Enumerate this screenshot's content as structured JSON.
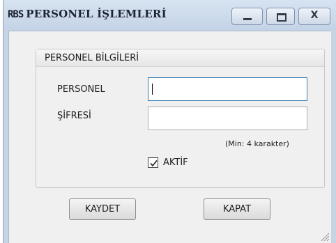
{
  "window": {
    "app_tag": "RBS",
    "title": "PERSONEL İŞLEMLERİ",
    "controls": {
      "minimize_icon": "minimize-icon",
      "maximize_icon": "maximize-icon",
      "close_icon": "close-icon",
      "close_glyph": "X"
    }
  },
  "group": {
    "title": "PERSONEL BİLGİLERİ"
  },
  "form": {
    "personel_label": "PERSONEL",
    "personel_value": "",
    "sifre_label": "ŞİFRESİ",
    "sifre_value": "",
    "sifre_hint": "(Min: 4 karakter)",
    "aktif_label": "AKTİF",
    "aktif_checked": true
  },
  "buttons": {
    "save_label": "KAYDET",
    "close_label": "KAPAT"
  },
  "colors": {
    "titlebar": "#c6d4e4",
    "client_background": "#f0f0f0",
    "focus_border": "#3c7fb1"
  }
}
